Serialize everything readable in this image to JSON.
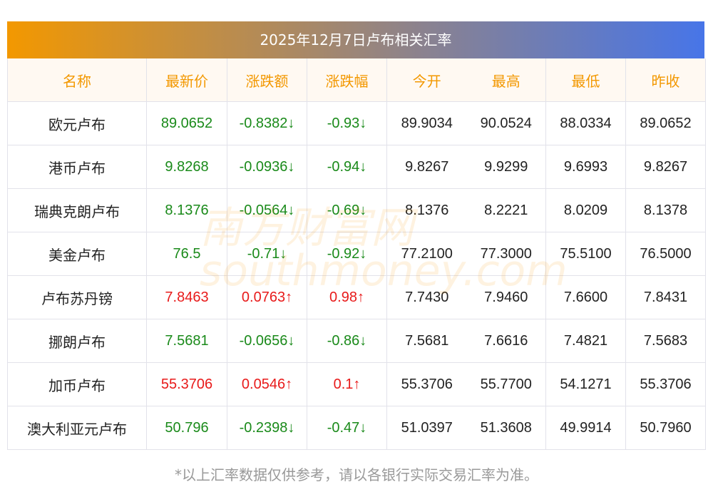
{
  "title": "2025年12月7日卢布相关汇率",
  "headers": [
    "名称",
    "最新价",
    "涨跌额",
    "涨跌幅",
    "今开",
    "最高",
    "最低",
    "昨收"
  ],
  "rows": [
    {
      "name": "欧元卢布",
      "latest": "89.0652",
      "change": "-0.8382↓",
      "pct": "-0.93↓",
      "open": "89.9034",
      "high": "90.0524",
      "low": "88.0334",
      "prev": "89.0652",
      "dir": "down"
    },
    {
      "name": "港币卢布",
      "latest": "9.8268",
      "change": "-0.0936↓",
      "pct": "-0.94↓",
      "open": "9.8267",
      "high": "9.9299",
      "low": "9.6993",
      "prev": "9.8267",
      "dir": "down"
    },
    {
      "name": "瑞典克朗卢布",
      "latest": "8.1376",
      "change": "-0.0564↓",
      "pct": "-0.69↓",
      "open": "8.1376",
      "high": "8.2221",
      "low": "8.0209",
      "prev": "8.1378",
      "dir": "down"
    },
    {
      "name": "美金卢布",
      "latest": "76.5",
      "change": "-0.71↓",
      "pct": "-0.92↓",
      "open": "77.2100",
      "high": "77.3000",
      "low": "75.5100",
      "prev": "76.5000",
      "dir": "down"
    },
    {
      "name": "卢布苏丹镑",
      "latest": "7.8463",
      "change": "0.0763↑",
      "pct": "0.98↑",
      "open": "7.7430",
      "high": "7.9460",
      "low": "7.6600",
      "prev": "7.8431",
      "dir": "up"
    },
    {
      "name": "挪朗卢布",
      "latest": "7.5681",
      "change": "-0.0656↓",
      "pct": "-0.86↓",
      "open": "7.5681",
      "high": "7.6616",
      "low": "7.4821",
      "prev": "7.5683",
      "dir": "down"
    },
    {
      "name": "加币卢布",
      "latest": "55.3706",
      "change": "0.0546↑",
      "pct": "0.1↑",
      "open": "55.3706",
      "high": "55.7700",
      "low": "54.1271",
      "prev": "55.3706",
      "dir": "up"
    },
    {
      "name": "澳大利亚元卢布",
      "latest": "50.796",
      "change": "-0.2398↓",
      "pct": "-0.47↓",
      "open": "51.0397",
      "high": "51.3608",
      "low": "49.9914",
      "prev": "50.7960",
      "dir": "down"
    }
  ],
  "watermark": "南方财富网 southmoney.com",
  "note": "*以上汇率数据仅供参考，请以各银行实际交易汇率为准。"
}
